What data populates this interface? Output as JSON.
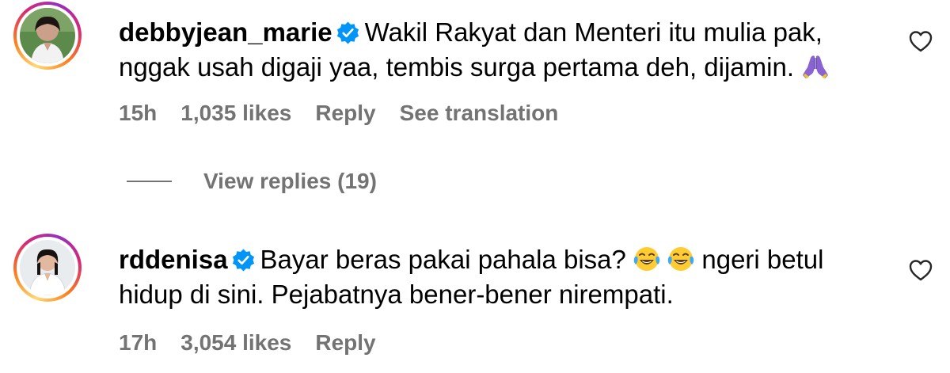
{
  "comments": [
    {
      "username": "debbyjean_marie",
      "verified": true,
      "text_line1": "Wakil Rakyat dan Menteri itu mulia pak,",
      "text_line2": "nggak usah digaji yaa, tembis surga pertama deh, dijamin.",
      "emoji": "folded-hands",
      "time": "15h",
      "likes": "1,035 likes",
      "reply_label": "Reply",
      "translation_label": "See translation"
    },
    {
      "username": "rddenisa",
      "verified": true,
      "text_part1": "Bayar beras pakai pahala bisa?",
      "emoji": "face-with-tears-of-joy",
      "text_part2": "ngeri betul",
      "text_line2": "hidup di sini. Pejabatnya bener-bener nirempati.",
      "time": "17h",
      "likes": "3,054 likes",
      "reply_label": "Reply"
    }
  ],
  "view_replies": {
    "label": "View replies (19)"
  },
  "icons": {
    "like": "heart-outline-icon",
    "verified": "verified-badge-icon"
  },
  "colors": {
    "verified_blue": "#0095f6",
    "meta_gray": "#737373",
    "text": "#000000"
  }
}
